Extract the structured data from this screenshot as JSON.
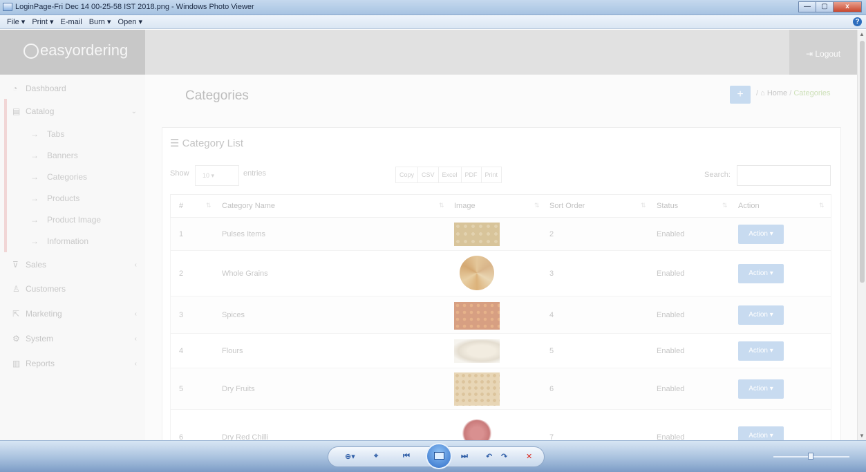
{
  "window": {
    "title": "LoginPage-Fri Dec 14 00-25-58 IST 2018.png - Windows Photo Viewer",
    "menu": [
      "File ▾",
      "Print ▾",
      "E-mail",
      "Burn ▾",
      "Open ▾"
    ],
    "help": "?",
    "close": "x"
  },
  "brand": {
    "name": "easyordering"
  },
  "topbar": {
    "logout_label": "Logout"
  },
  "sidebar": {
    "items": [
      {
        "icon": "dashboard-icon",
        "label": "Dashboard"
      },
      {
        "icon": "catalog-icon",
        "label": "Catalog",
        "expanded": true
      },
      {
        "icon": "cart-icon",
        "label": "Sales"
      },
      {
        "icon": "user-icon",
        "label": "Customers"
      },
      {
        "icon": "share-icon",
        "label": "Marketing"
      },
      {
        "icon": "gear-icon",
        "label": "System"
      },
      {
        "icon": "bar-chart-icon",
        "label": "Reports"
      }
    ],
    "catalog_subitems": [
      "Tabs",
      "Banners",
      "Categories",
      "Products",
      "Product Image",
      "Information"
    ]
  },
  "page": {
    "title": "Categories",
    "breadcrumb": {
      "home": "Home",
      "separator": "/",
      "current": "Categories"
    }
  },
  "panel": {
    "title": "Category List",
    "show_label": "Show",
    "entries_value": "10",
    "entries_label": "entries",
    "export_buttons": [
      "Copy",
      "CSV",
      "Excel",
      "PDF",
      "Print"
    ],
    "search_label": "Search:"
  },
  "table": {
    "columns": [
      "#",
      "Category Name",
      "Image",
      "Sort Order",
      "Status",
      "Action"
    ],
    "rows": [
      {
        "num": "1",
        "name": "Pulses Items",
        "sort": "2",
        "status": "Enabled",
        "action": "Action ▾"
      },
      {
        "num": "2",
        "name": "Whole Grains",
        "sort": "3",
        "status": "Enabled",
        "action": "Action ▾"
      },
      {
        "num": "3",
        "name": "Spices",
        "sort": "4",
        "status": "Enabled",
        "action": "Action ▾"
      },
      {
        "num": "4",
        "name": "Flours",
        "sort": "5",
        "status": "Enabled",
        "action": "Action ▾"
      },
      {
        "num": "5",
        "name": "Dry Fruits",
        "sort": "6",
        "status": "Enabled",
        "action": "Action ▾"
      },
      {
        "num": "6",
        "name": "Dry Red Chilli",
        "sort": "7",
        "status": "Enabled",
        "action": "Action ▾"
      }
    ]
  },
  "colors": {
    "accent": "#c8dbf0",
    "sidebar_active": "#f1d6d6",
    "toolbar_blue": "#2f5ea7"
  }
}
